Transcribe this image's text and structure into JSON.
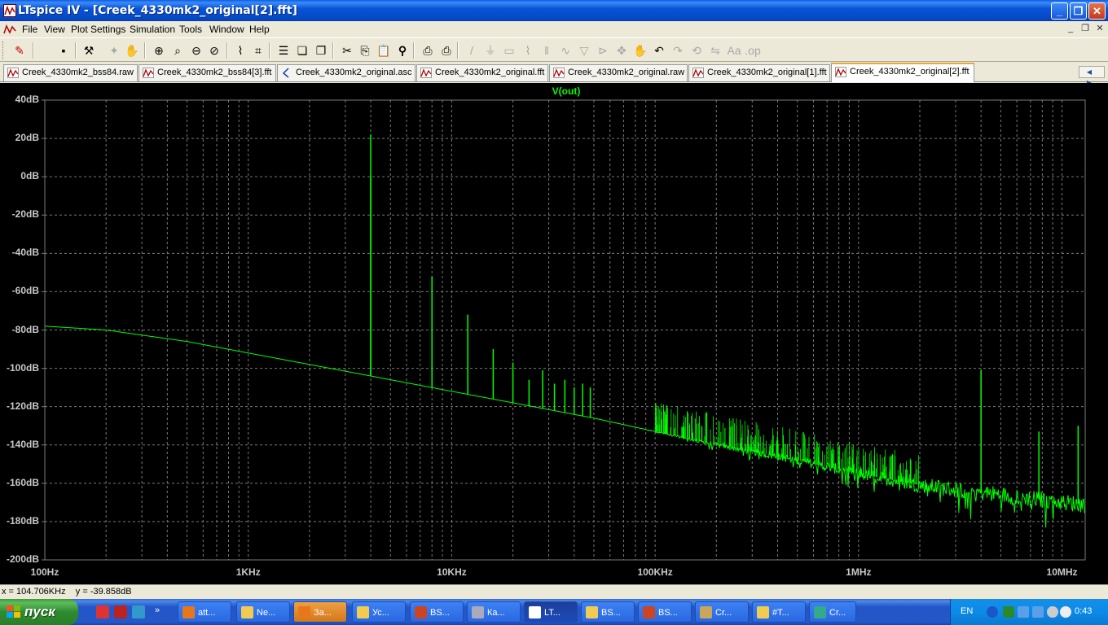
{
  "window": {
    "title": "LTspice IV - [Creek_4330mk2_original[2].fft]",
    "min_icon": "minimize-icon",
    "max_icon": "maximize-icon",
    "close_icon": "close-icon",
    "min_glyph": "_",
    "max_glyph": "❐",
    "close_glyph": "✕"
  },
  "menu": {
    "items": [
      "File",
      "View",
      "Plot Settings",
      "Simulation",
      "Tools",
      "Window",
      "Help"
    ],
    "mdi_min": "_",
    "mdi_restore": "❐",
    "mdi_close": "✕"
  },
  "toolbar": {
    "buttons": [
      {
        "name": "open-icon",
        "glyph": "✎",
        "enabled": true
      },
      {
        "name": "save-icon",
        "glyph": "▪",
        "enabled": true
      },
      {
        "name": "hammer-icon",
        "glyph": "⚒",
        "enabled": true
      },
      {
        "name": "halt-icon",
        "glyph": "✦",
        "enabled": false
      },
      {
        "name": "pan-hand-icon",
        "glyph": "✋",
        "enabled": false
      },
      {
        "name": "zoom-in-icon",
        "glyph": "⊕",
        "enabled": true
      },
      {
        "name": "zoom-area-icon",
        "glyph": "⌕",
        "enabled": true
      },
      {
        "name": "zoom-out-icon",
        "glyph": "⊖",
        "enabled": true
      },
      {
        "name": "zoom-cancel-icon",
        "glyph": "⊘",
        "enabled": true
      },
      {
        "name": "autorange-icon",
        "glyph": "⌇",
        "enabled": true
      },
      {
        "name": "grid-icon",
        "glyph": "⌗",
        "enabled": true
      },
      {
        "name": "tile-horizontal-icon",
        "glyph": "☰",
        "enabled": true
      },
      {
        "name": "cascade-icon",
        "glyph": "❏",
        "enabled": true
      },
      {
        "name": "tile-vertical-icon",
        "glyph": "❐",
        "enabled": true
      },
      {
        "name": "cut-icon",
        "glyph": "✂",
        "enabled": true
      },
      {
        "name": "copy-icon",
        "glyph": "⎘",
        "enabled": true
      },
      {
        "name": "paste-icon",
        "glyph": "📋",
        "enabled": true
      },
      {
        "name": "find-icon",
        "glyph": "⚲",
        "enabled": true
      },
      {
        "name": "print-setup-icon",
        "glyph": "⎙",
        "enabled": true
      },
      {
        "name": "print-icon",
        "glyph": "⎙",
        "enabled": true
      },
      {
        "name": "wire-icon",
        "glyph": "/",
        "enabled": false
      },
      {
        "name": "ground-icon",
        "glyph": "⏚",
        "enabled": false
      },
      {
        "name": "label-icon",
        "glyph": "▭",
        "enabled": false
      },
      {
        "name": "resistor-icon",
        "glyph": "⌇",
        "enabled": false
      },
      {
        "name": "capacitor-icon",
        "glyph": "‖",
        "enabled": false
      },
      {
        "name": "inductor-icon",
        "glyph": "∿",
        "enabled": false
      },
      {
        "name": "diode-icon",
        "glyph": "▽",
        "enabled": false
      },
      {
        "name": "component-icon",
        "glyph": "⊳",
        "enabled": false
      },
      {
        "name": "move-icon",
        "glyph": "✥",
        "enabled": false
      },
      {
        "name": "drag-icon",
        "glyph": "✋",
        "enabled": false
      },
      {
        "name": "undo-icon",
        "glyph": "↶",
        "enabled": true
      },
      {
        "name": "redo-icon",
        "glyph": "↷",
        "enabled": false
      },
      {
        "name": "rotate-icon",
        "glyph": "⟲",
        "enabled": false
      },
      {
        "name": "mirror-icon",
        "glyph": "⇋",
        "enabled": false
      },
      {
        "name": "text-icon",
        "glyph": "Aa",
        "enabled": false
      },
      {
        "name": "spice-directive-icon",
        "glyph": ".op",
        "enabled": false
      }
    ]
  },
  "tabs": [
    {
      "label": "Creek_4330mk2_bss84.raw",
      "icon": "waveform-icon",
      "active": false
    },
    {
      "label": "Creek_4330mk2_bss84[3].fft",
      "icon": "waveform-icon",
      "active": false
    },
    {
      "label": "Creek_4330mk2_original.asc",
      "icon": "schematic-icon",
      "active": false
    },
    {
      "label": "Creek_4330mk2_original.fft",
      "icon": "waveform-icon",
      "active": false
    },
    {
      "label": "Creek_4330mk2_original.raw",
      "icon": "waveform-icon",
      "active": false
    },
    {
      "label": "Creek_4330mk2_original[1].fft",
      "icon": "waveform-icon",
      "active": false
    },
    {
      "label": "Creek_4330mk2_original[2].fft",
      "icon": "waveform-icon",
      "active": true
    }
  ],
  "tab_nav": "◀ ▶",
  "colors": {
    "trace": "#00ff00",
    "grid": "#7a7a7a",
    "background": "#000000",
    "axis_text": "#c8c8c8"
  },
  "chart_data": {
    "type": "line",
    "title": "V(out)",
    "x_scale": "log",
    "xlim": [
      100,
      13000000
    ],
    "ylim": [
      -200,
      40
    ],
    "y_ticks": [
      "40dB",
      "20dB",
      "0dB",
      "-20dB",
      "-40dB",
      "-60dB",
      "-80dB",
      "-100dB",
      "-120dB",
      "-140dB",
      "-160dB",
      "-180dB",
      "-200dB"
    ],
    "x_ticks": [
      "100Hz",
      "1KHz",
      "10KHz",
      "100KHz",
      "1MHz",
      "10MHz"
    ],
    "grid": true,
    "series": [
      {
        "name": "V(out)",
        "noise_floor": [
          [
            100,
            -78
          ],
          [
            200,
            -80
          ],
          [
            500,
            -86
          ],
          [
            1000,
            -92
          ],
          [
            2000,
            -98
          ],
          [
            4000,
            -104
          ],
          [
            10000,
            -112
          ],
          [
            20000,
            -118
          ],
          [
            50000,
            -126
          ],
          [
            100000,
            -133
          ],
          [
            200000,
            -140
          ],
          [
            500000,
            -148
          ],
          [
            1000000,
            -155
          ],
          [
            2000000,
            -161
          ],
          [
            5000000,
            -166
          ],
          [
            10000000,
            -170
          ],
          [
            13000000,
            -171
          ]
        ],
        "peaks": [
          [
            4000,
            22
          ],
          [
            4000,
            0
          ],
          [
            8000,
            -52
          ],
          [
            12000,
            -72
          ],
          [
            16000,
            -90
          ],
          [
            20000,
            -97
          ],
          [
            24000,
            -106
          ],
          [
            28000,
            -101
          ],
          [
            32000,
            -108
          ],
          [
            36000,
            -106
          ],
          [
            40000,
            -110
          ],
          [
            44000,
            -108
          ],
          [
            48000,
            -110
          ],
          [
            4000000,
            -101
          ],
          [
            7700000,
            -133
          ],
          [
            12000000,
            -130
          ]
        ]
      }
    ]
  },
  "status": {
    "text": "x = 104.706KHz    y = -39.858dB"
  },
  "taskbar": {
    "start_label": "пуск",
    "tasks": [
      {
        "label": "att...",
        "icon": "firefox-icon",
        "active": false,
        "hl": false
      },
      {
        "label": "Ne...",
        "icon": "folder-icon",
        "active": false,
        "hl": false
      },
      {
        "label": "За...",
        "icon": "firefox-icon",
        "active": false,
        "hl": true
      },
      {
        "label": "Ус...",
        "icon": "folder-icon",
        "active": false,
        "hl": false
      },
      {
        "label": "BS...",
        "icon": "pdf-icon",
        "active": false,
        "hl": false
      },
      {
        "label": "Ка...",
        "icon": "calculator-icon",
        "active": false,
        "hl": false
      },
      {
        "label": "LT...",
        "icon": "ltspice-icon",
        "active": true,
        "hl": false
      },
      {
        "label": "BS...",
        "icon": "folder-icon",
        "active": false,
        "hl": false
      },
      {
        "label": "BS...",
        "icon": "pdf-icon",
        "active": false,
        "hl": false
      },
      {
        "label": "Cr...",
        "icon": "app-icon",
        "active": false,
        "hl": false
      },
      {
        "label": "#T...",
        "icon": "folder-icon",
        "active": false,
        "hl": false
      },
      {
        "label": "Cr...",
        "icon": "image-icon",
        "active": false,
        "hl": false
      }
    ],
    "lang": "EN",
    "clock": "0:43"
  }
}
